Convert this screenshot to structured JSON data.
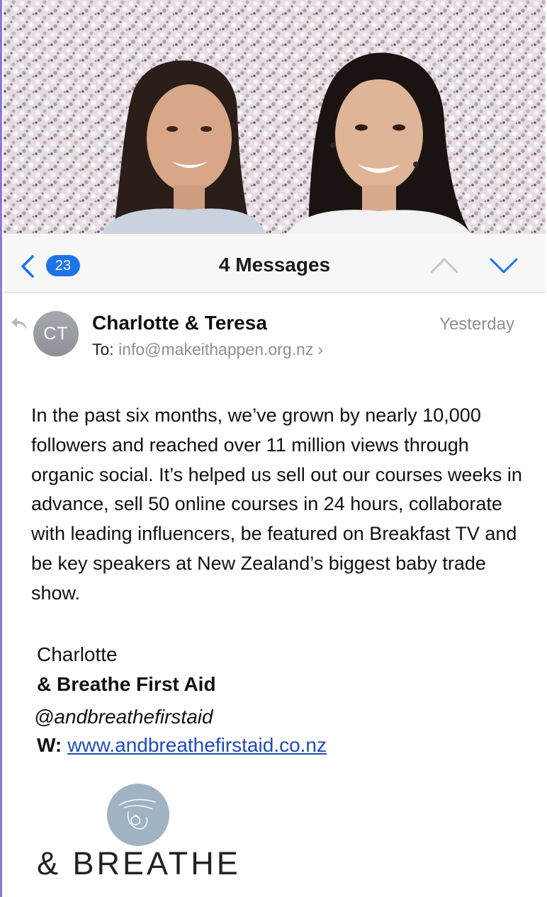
{
  "nav": {
    "unread_count": "23",
    "title": "4 Messages"
  },
  "message": {
    "avatar_initials": "CT",
    "sender": "Charlotte & Teresa",
    "date": "Yesterday",
    "to_label": "To:",
    "to_address": "info@makeithappen.org.nz",
    "body": "In the past six months, we’ve grown by nearly 10,000 followers and reached over 11 million views through organic social. It’s helped us sell out our courses weeks in advance, sell 50 online courses in 24 hours, collaborate with leading influencers, be featured on Breakfast TV and be key speakers at New Zealand’s biggest baby trade show."
  },
  "signature": {
    "name": "Charlotte",
    "org": "& Breathe First Aid",
    "handle": "@andbreathefirstaid",
    "web_label": "W:",
    "web_url": "www.andbreathefirstaid.co.nz"
  },
  "logo": {
    "wordmark": "& BREATHE",
    "circle_color": "#9fb3c2"
  },
  "icons": [
    "back-chevron-icon",
    "up-chevron-icon",
    "down-chevron-icon",
    "reply-icon",
    "disclosure-chevron-icon"
  ],
  "colors": {
    "accent": "#1c74e8",
    "link": "#1f4bb8",
    "secondary_text": "#8e8e93"
  }
}
